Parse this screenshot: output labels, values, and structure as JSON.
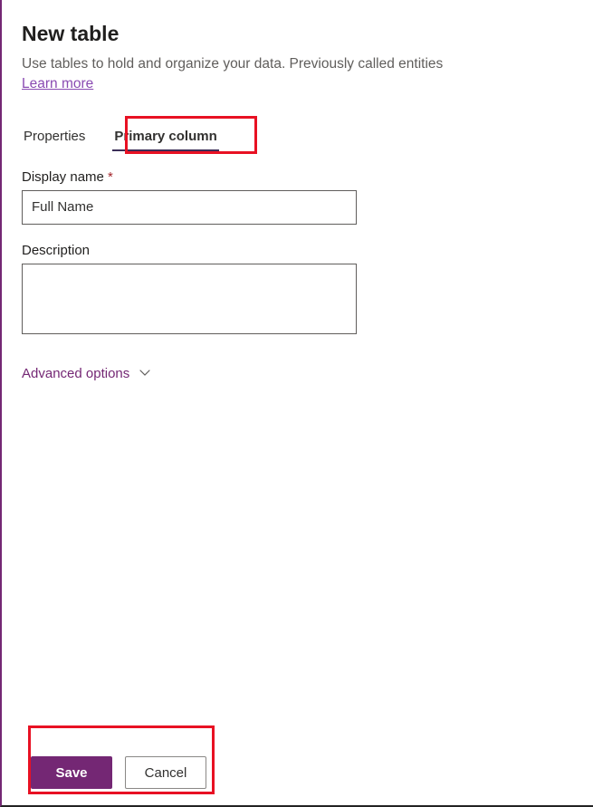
{
  "header": {
    "title": "New table",
    "subtitle": "Use tables to hold and organize your data. Previously called entities",
    "learn_more": "Learn more"
  },
  "tabs": [
    {
      "label": "Properties",
      "active": false
    },
    {
      "label": "Primary column",
      "active": true
    }
  ],
  "form": {
    "display_name_label": "Display name",
    "display_name_value": "Full Name",
    "description_label": "Description",
    "description_value": ""
  },
  "advanced_options_label": "Advanced options",
  "buttons": {
    "save": "Save",
    "cancel": "Cancel"
  },
  "colors": {
    "accent": "#742774",
    "link": "#8a4bb2",
    "highlight": "#e81123"
  }
}
